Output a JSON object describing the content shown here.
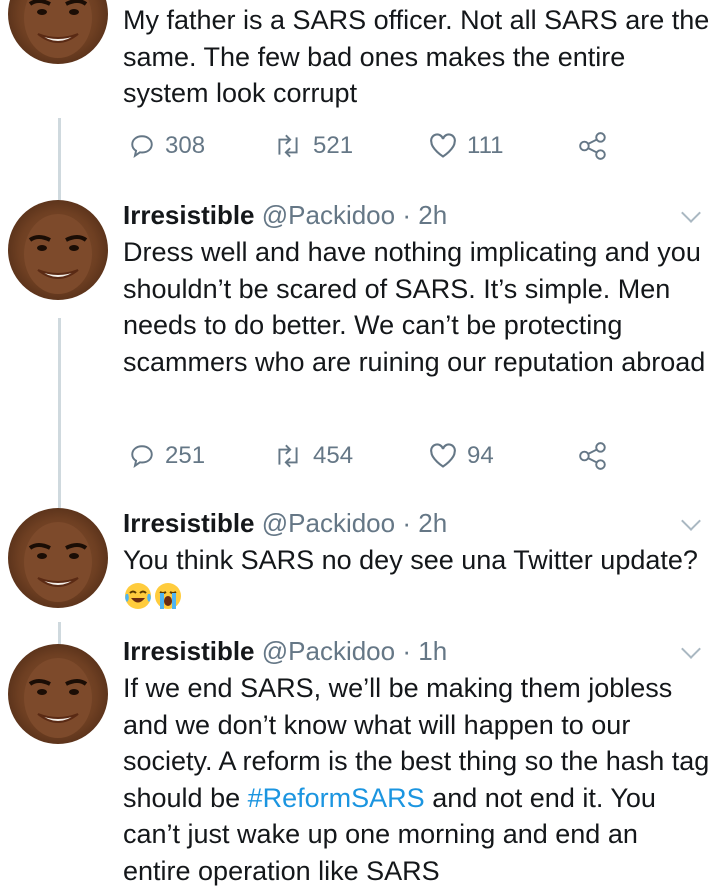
{
  "colors": {
    "text": "#14171a",
    "muted": "#657786",
    "link": "#1b95e0",
    "thread_line": "#cfd9de"
  },
  "tweets": [
    {
      "text": "My father is a SARS officer. Not all SARS are the same. The few bad ones makes the entire system look corrupt",
      "replies": "308",
      "retweets": "521",
      "likes": "111"
    },
    {
      "name": "Irresistible",
      "handle": "@Packidoo",
      "separator": "·",
      "time": "2h",
      "text": "Dress well and have nothing implicating and you shouldn’t be scared of SARS. It’s simple. Men needs to do better. We can’t be protecting scammers who are ruining our reputation abroad",
      "replies": "251",
      "retweets": "454",
      "likes": "94"
    },
    {
      "name": "Irresistible",
      "handle": "@Packidoo",
      "separator": "·",
      "time": "2h",
      "text_before": "You think SARS no dey see una Twitter update?",
      "emojis": [
        "face-with-tears-of-joy-emoji",
        "loudly-crying-face-emoji"
      ]
    },
    {
      "name": "Irresistible",
      "handle": "@Packidoo",
      "separator": "·",
      "time": "1h",
      "text_before": "If we end SARS, we’ll be making them jobless and we don’t know what will happen to our society. A reform is the best thing so the hash tag should be",
      "hashtag": "#ReformSARS",
      "text_after": "and not end it. You can’t just wake up one morning and end an entire operation like SARS"
    }
  ]
}
